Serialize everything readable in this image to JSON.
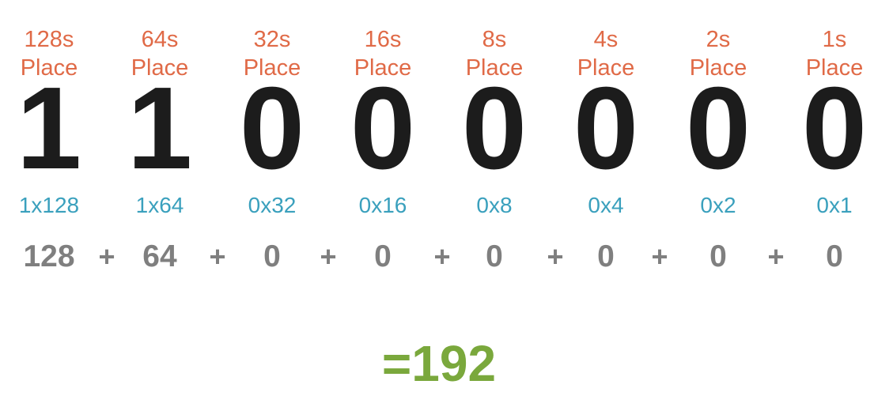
{
  "colors": {
    "place_label": "#e06a47",
    "bit": "#1c1c1c",
    "multiplication": "#3aa0bd",
    "sum_terms": "#7f7f7f",
    "result": "#7aa83c"
  },
  "columns": [
    {
      "place_line1": "128s",
      "place_line2": "Place",
      "bit": "1",
      "multiplication": "1x128",
      "value": "128"
    },
    {
      "place_line1": "64s",
      "place_line2": "Place",
      "bit": "1",
      "multiplication": "1x64",
      "value": "64"
    },
    {
      "place_line1": "32s",
      "place_line2": "Place",
      "bit": "0",
      "multiplication": "0x32",
      "value": "0"
    },
    {
      "place_line1": "16s",
      "place_line2": "Place",
      "bit": "0",
      "multiplication": "0x16",
      "value": "0"
    },
    {
      "place_line1": "8s",
      "place_line2": "Place",
      "bit": "0",
      "multiplication": "0x8",
      "value": "0"
    },
    {
      "place_line1": "4s",
      "place_line2": "Place",
      "bit": "0",
      "multiplication": "0x4",
      "value": "0"
    },
    {
      "place_line1": "2s",
      "place_line2": "Place",
      "bit": "0",
      "multiplication": "0x2",
      "value": "0"
    },
    {
      "place_line1": "1s",
      "place_line2": "Place",
      "bit": "0",
      "multiplication": "0x1",
      "value": "0"
    }
  ],
  "operator": "+",
  "result": "=192"
}
